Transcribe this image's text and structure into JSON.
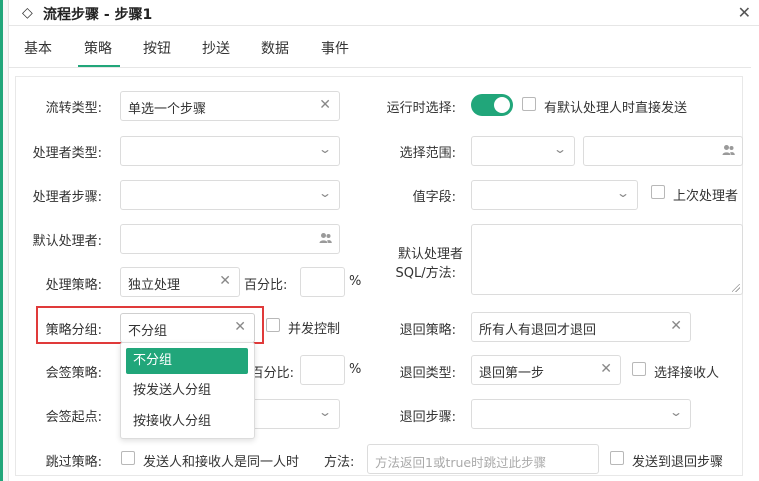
{
  "window": {
    "title": "流程步骤 - 步骤1"
  },
  "tabs": [
    {
      "label": "基本"
    },
    {
      "label": "策略"
    },
    {
      "label": "按钮"
    },
    {
      "label": "抄送"
    },
    {
      "label": "数据"
    },
    {
      "label": "事件"
    }
  ],
  "active_tab": "策略",
  "form": {
    "flow_type": {
      "label": "流转类型:",
      "value": "单选一个步骤"
    },
    "handler_type": {
      "label": "处理者类型:",
      "value": ""
    },
    "handler_step": {
      "label": "处理者步骤:",
      "value": ""
    },
    "default_handler": {
      "label": "默认处理者:",
      "value": ""
    },
    "handle_strategy": {
      "label": "处理策略:",
      "value": "独立处理"
    },
    "percent": {
      "label": "百分比:",
      "value": "",
      "unit": "%"
    },
    "strategy_group": {
      "label": "策略分组:",
      "value": "不分组"
    },
    "concurrent_control": {
      "label": "并发控制",
      "checked": false
    },
    "countersign_strategy": {
      "label": "会签策略:"
    },
    "percent2": {
      "label": "百分比:",
      "value": "",
      "unit": "%"
    },
    "countersign_start": {
      "label": "会签起点:"
    },
    "skip_strategy": {
      "label": "跳过策略:"
    },
    "skip_same_person": {
      "label": "发送人和接收人是同一人时",
      "checked": false
    },
    "method": {
      "label": "方法:",
      "placeholder": "方法返回1或true时跳过此步骤"
    },
    "send_to_return_step": {
      "label": "发送到退回步骤",
      "checked": false
    },
    "runtime_select": {
      "label": "运行时选择:",
      "on": true
    },
    "send_direct": {
      "label": "有默认处理人时直接发送",
      "checked": false
    },
    "select_range": {
      "label": "选择范围:"
    },
    "value_field": {
      "label": "值字段:"
    },
    "last_handler": {
      "label": "上次处理者",
      "checked": false
    },
    "default_handler_sql": {
      "label_line1": "默认处理者",
      "label_line2": "SQL/方法:",
      "value": ""
    },
    "return_strategy": {
      "label": "退回策略:",
      "value": "所有人有退回才退回"
    },
    "return_type": {
      "label": "退回类型:",
      "value": "退回第一步"
    },
    "select_receiver": {
      "label": "选择接收人",
      "checked": false
    },
    "return_step": {
      "label": "退回步骤:"
    }
  },
  "dropdown": {
    "options": [
      "不分组",
      "按发送人分组",
      "按接收人分组"
    ],
    "selected": "不分组"
  },
  "colors": {
    "accent": "#21a67a",
    "highlight": "#e03a3a"
  }
}
